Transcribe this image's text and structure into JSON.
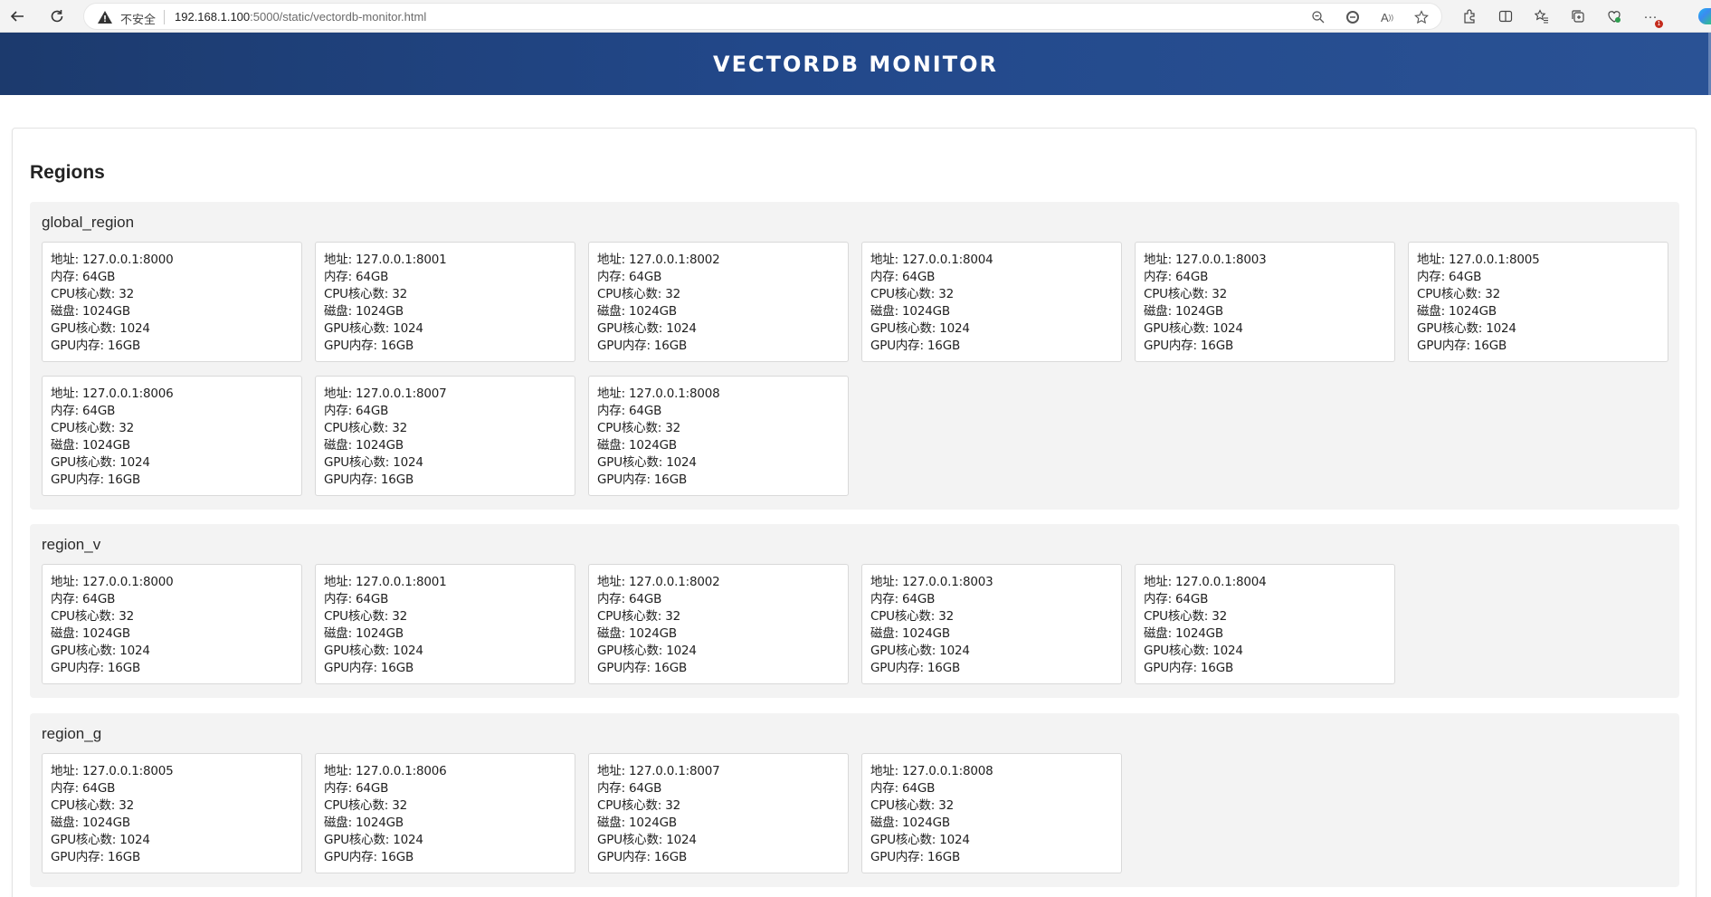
{
  "browser": {
    "insecure_label": "不安全",
    "url_host": "192.168.1.100",
    "url_rest": ":5000/static/vectordb-monitor.html",
    "icons": [
      "back-icon",
      "refresh-icon",
      "warning-icon",
      "zoom-out-icon",
      "edge-refresh-icon",
      "read-aloud-icon",
      "favorite-star-icon",
      "extensions-icon",
      "split-screen-icon",
      "favorites-icon",
      "collections-icon",
      "browser-essentials-icon",
      "more-icon",
      "copilot-icon"
    ],
    "more_badge": "1"
  },
  "header": {
    "title": "VECTORDB MONITOR"
  },
  "main": {
    "title": "Regions",
    "regions": [
      {
        "name": "global_region",
        "nodes": [
          {
            "addr": "地址: 127.0.0.1:8000",
            "mem": "内存: 64GB",
            "cpu": "CPU核心数: 32",
            "disk": "磁盘: 1024GB",
            "gpu_cores": "GPU核心数: 1024",
            "gpu_mem": "GPU内存: 16GB"
          },
          {
            "addr": "地址: 127.0.0.1:8001",
            "mem": "内存: 64GB",
            "cpu": "CPU核心数: 32",
            "disk": "磁盘: 1024GB",
            "gpu_cores": "GPU核心数: 1024",
            "gpu_mem": "GPU内存: 16GB"
          },
          {
            "addr": "地址: 127.0.0.1:8002",
            "mem": "内存: 64GB",
            "cpu": "CPU核心数: 32",
            "disk": "磁盘: 1024GB",
            "gpu_cores": "GPU核心数: 1024",
            "gpu_mem": "GPU内存: 16GB"
          },
          {
            "addr": "地址: 127.0.0.1:8004",
            "mem": "内存: 64GB",
            "cpu": "CPU核心数: 32",
            "disk": "磁盘: 1024GB",
            "gpu_cores": "GPU核心数: 1024",
            "gpu_mem": "GPU内存: 16GB"
          },
          {
            "addr": "地址: 127.0.0.1:8003",
            "mem": "内存: 64GB",
            "cpu": "CPU核心数: 32",
            "disk": "磁盘: 1024GB",
            "gpu_cores": "GPU核心数: 1024",
            "gpu_mem": "GPU内存: 16GB"
          },
          {
            "addr": "地址: 127.0.0.1:8005",
            "mem": "内存: 64GB",
            "cpu": "CPU核心数: 32",
            "disk": "磁盘: 1024GB",
            "gpu_cores": "GPU核心数: 1024",
            "gpu_mem": "GPU内存: 16GB"
          },
          {
            "addr": "地址: 127.0.0.1:8006",
            "mem": "内存: 64GB",
            "cpu": "CPU核心数: 32",
            "disk": "磁盘: 1024GB",
            "gpu_cores": "GPU核心数: 1024",
            "gpu_mem": "GPU内存: 16GB"
          },
          {
            "addr": "地址: 127.0.0.1:8007",
            "mem": "内存: 64GB",
            "cpu": "CPU核心数: 32",
            "disk": "磁盘: 1024GB",
            "gpu_cores": "GPU核心数: 1024",
            "gpu_mem": "GPU内存: 16GB"
          },
          {
            "addr": "地址: 127.0.0.1:8008",
            "mem": "内存: 64GB",
            "cpu": "CPU核心数: 32",
            "disk": "磁盘: 1024GB",
            "gpu_cores": "GPU核心数: 1024",
            "gpu_mem": "GPU内存: 16GB"
          }
        ]
      },
      {
        "name": "region_v",
        "nodes": [
          {
            "addr": "地址: 127.0.0.1:8000",
            "mem": "内存: 64GB",
            "cpu": "CPU核心数: 32",
            "disk": "磁盘: 1024GB",
            "gpu_cores": "GPU核心数: 1024",
            "gpu_mem": "GPU内存: 16GB"
          },
          {
            "addr": "地址: 127.0.0.1:8001",
            "mem": "内存: 64GB",
            "cpu": "CPU核心数: 32",
            "disk": "磁盘: 1024GB",
            "gpu_cores": "GPU核心数: 1024",
            "gpu_mem": "GPU内存: 16GB"
          },
          {
            "addr": "地址: 127.0.0.1:8002",
            "mem": "内存: 64GB",
            "cpu": "CPU核心数: 32",
            "disk": "磁盘: 1024GB",
            "gpu_cores": "GPU核心数: 1024",
            "gpu_mem": "GPU内存: 16GB"
          },
          {
            "addr": "地址: 127.0.0.1:8003",
            "mem": "内存: 64GB",
            "cpu": "CPU核心数: 32",
            "disk": "磁盘: 1024GB",
            "gpu_cores": "GPU核心数: 1024",
            "gpu_mem": "GPU内存: 16GB"
          },
          {
            "addr": "地址: 127.0.0.1:8004",
            "mem": "内存: 64GB",
            "cpu": "CPU核心数: 32",
            "disk": "磁盘: 1024GB",
            "gpu_cores": "GPU核心数: 1024",
            "gpu_mem": "GPU内存: 16GB"
          }
        ]
      },
      {
        "name": "region_g",
        "nodes": [
          {
            "addr": "地址: 127.0.0.1:8005",
            "mem": "内存: 64GB",
            "cpu": "CPU核心数: 32",
            "disk": "磁盘: 1024GB",
            "gpu_cores": "GPU核心数: 1024",
            "gpu_mem": "GPU内存: 16GB"
          },
          {
            "addr": "地址: 127.0.0.1:8006",
            "mem": "内存: 64GB",
            "cpu": "CPU核心数: 32",
            "disk": "磁盘: 1024GB",
            "gpu_cores": "GPU核心数: 1024",
            "gpu_mem": "GPU内存: 16GB"
          },
          {
            "addr": "地址: 127.0.0.1:8007",
            "mem": "内存: 64GB",
            "cpu": "CPU核心数: 32",
            "disk": "磁盘: 1024GB",
            "gpu_cores": "GPU核心数: 1024",
            "gpu_mem": "GPU内存: 16GB"
          },
          {
            "addr": "地址: 127.0.0.1:8008",
            "mem": "内存: 64GB",
            "cpu": "CPU核心数: 32",
            "disk": "磁盘: 1024GB",
            "gpu_cores": "GPU核心数: 1024",
            "gpu_mem": "GPU内存: 16GB"
          }
        ]
      }
    ]
  },
  "colors": {
    "header_start": "#1c3a6d",
    "header_end": "#2a5295",
    "region_bg": "#f3f3f3",
    "card_border": "#d9d9d9"
  }
}
